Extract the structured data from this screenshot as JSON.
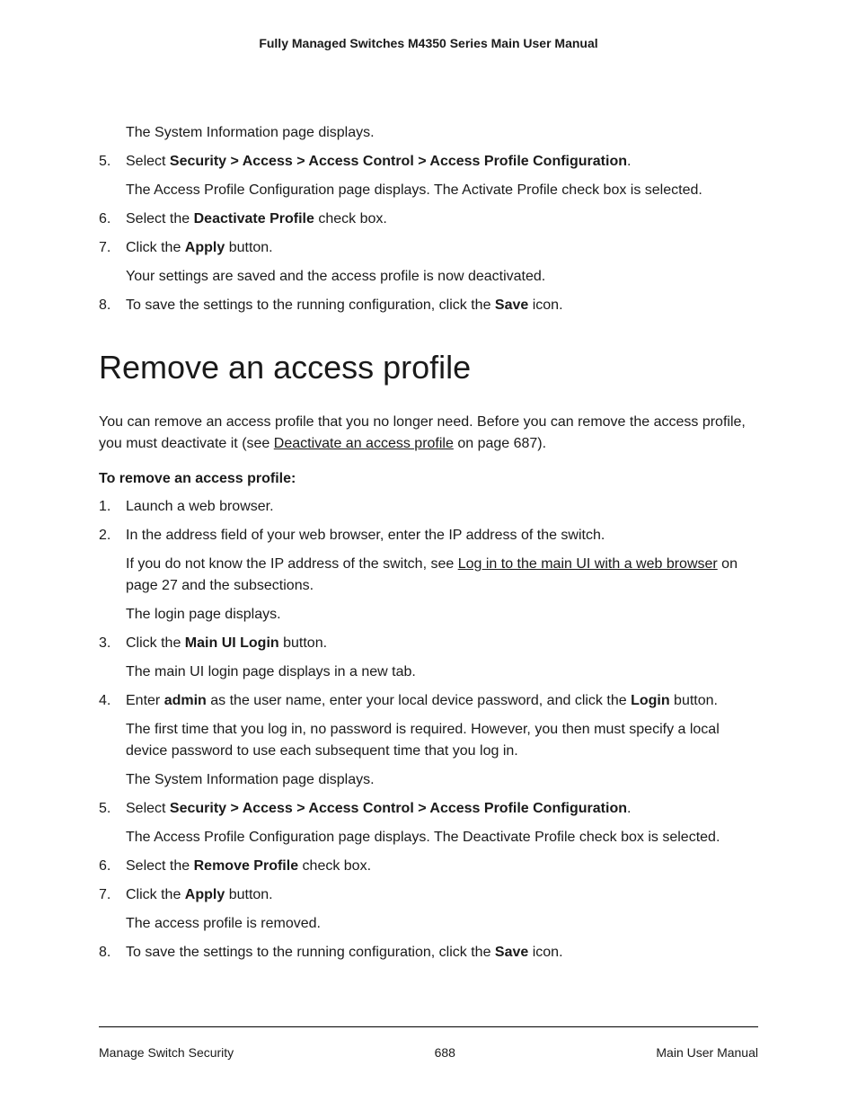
{
  "header": {
    "title": "Fully Managed Switches M4350 Series Main User Manual"
  },
  "section1": {
    "intro": "The System Information page displays.",
    "steps": [
      {
        "prefix": "Select ",
        "bold1": "Security > Access > Access Control > Access Profile Configuration",
        "suffix1": ".",
        "cont1": "The Access Profile Configuration page displays. The Activate Profile check box is selected."
      },
      {
        "prefix": "Select the ",
        "bold1": "Deactivate Profile",
        "suffix1": " check box."
      },
      {
        "prefix": "Click the ",
        "bold1": "Apply",
        "suffix1": " button.",
        "cont1": "Your settings are saved and the access profile is now deactivated."
      },
      {
        "prefix": "To save the settings to the running configuration, click the ",
        "bold1": "Save",
        "suffix1": " icon."
      }
    ]
  },
  "heading": "Remove an access profile",
  "intro": {
    "text1": "You can remove an access profile that you no longer need. Before you can remove the access profile, you must deactivate it (see ",
    "link1": "Deactivate an access profile",
    "text2": " on page 687)."
  },
  "subheading": "To remove an access profile:",
  "section2": {
    "steps": [
      {
        "prefix": "Launch a web browser."
      },
      {
        "prefix": "In the address field of your web browser, enter the IP address of the switch.",
        "cont1a": "If you do not know the IP address of the switch, see ",
        "cont1link": "Log in to the main UI with a web browser",
        "cont1b": " on page 27 and the subsections.",
        "cont2": "The login page displays."
      },
      {
        "prefix": "Click the ",
        "bold1": "Main UI Login",
        "suffix1": " button.",
        "cont1": "The main UI login page displays in a new tab."
      },
      {
        "prefix": "Enter ",
        "bold1": "admin",
        "mid1": " as the user name, enter your local device password, and click the ",
        "bold2": "Login",
        "suffix1": " button.",
        "cont1": "The first time that you log in, no password is required. However, you then must specify a local device password to use each subsequent time that you log in.",
        "cont2": "The System Information page displays."
      },
      {
        "prefix": "Select ",
        "bold1": "Security > Access > Access Control > Access Profile Configuration",
        "suffix1": ".",
        "cont1": "The Access Profile Configuration page displays. The Deactivate Profile check box is selected."
      },
      {
        "prefix": "Select the ",
        "bold1": "Remove Profile",
        "suffix1": " check box."
      },
      {
        "prefix": "Click the ",
        "bold1": "Apply",
        "suffix1": " button.",
        "cont1": "The access profile is removed."
      },
      {
        "prefix": "To save the settings to the running configuration, click the ",
        "bold1": "Save",
        "suffix1": " icon."
      }
    ]
  },
  "footer": {
    "left": "Manage Switch Security",
    "center": "688",
    "right": "Main User Manual"
  }
}
